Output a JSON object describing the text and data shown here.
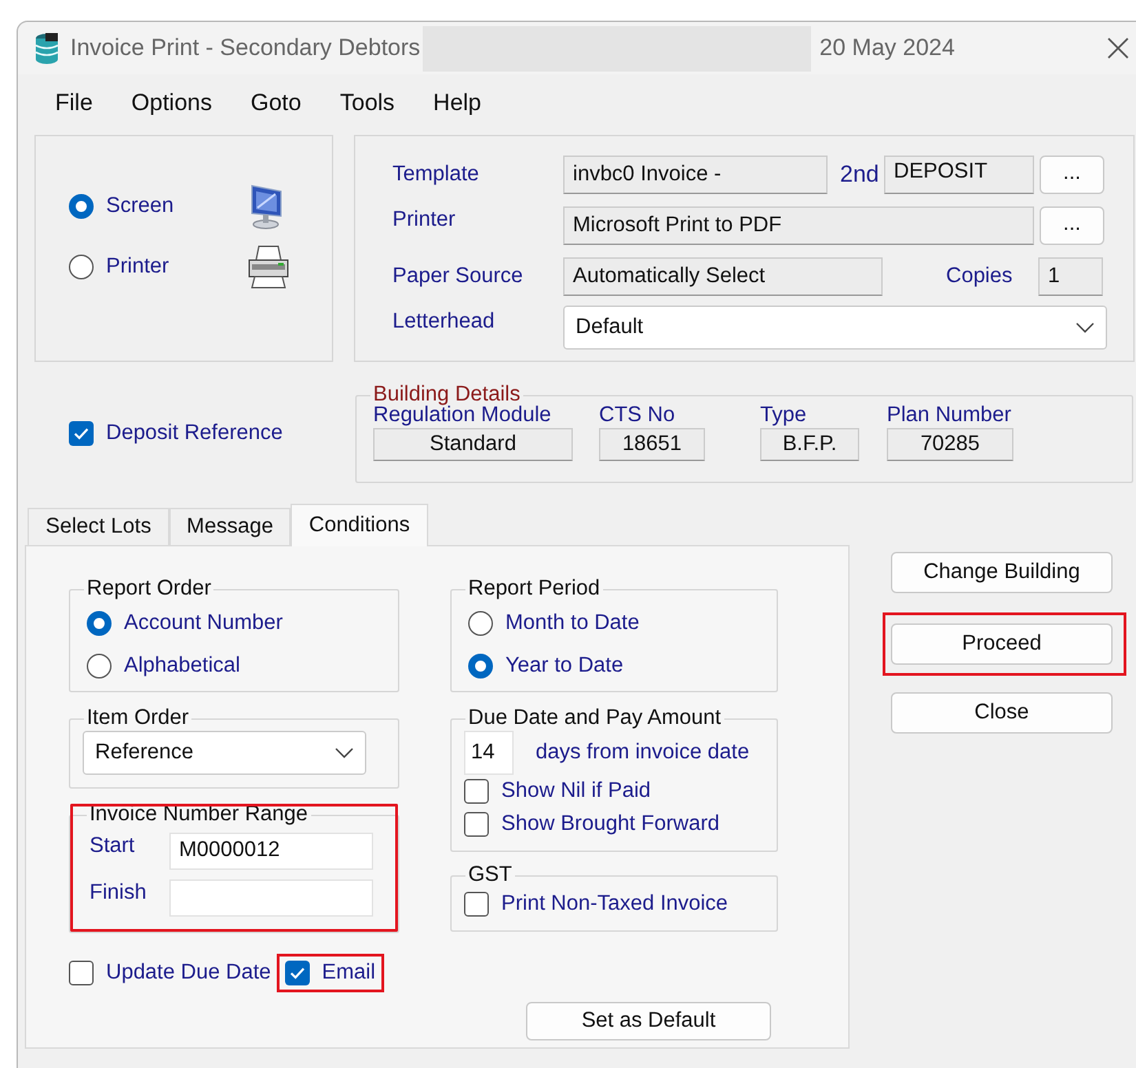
{
  "window": {
    "title": "Invoice Print - Secondary Debtors",
    "date": "20 May 2024"
  },
  "menu": [
    "File",
    "Options",
    "Goto",
    "Tools",
    "Help"
  ],
  "output": {
    "options": [
      {
        "label": "Screen",
        "kind": "screen",
        "selected": true
      },
      {
        "label": "Printer",
        "kind": "printer",
        "selected": false
      }
    ]
  },
  "print_settings": {
    "template": {
      "label": "Template",
      "value": "invbc0 Invoice -",
      "second_label": "2nd",
      "second_value": "DEPOSIT",
      "browse": "..."
    },
    "printer": {
      "label": "Printer",
      "value": "Microsoft Print to PDF",
      "browse": "..."
    },
    "paper_source": {
      "label": "Paper Source",
      "value": "Automatically Select"
    },
    "copies": {
      "label": "Copies",
      "value": "1"
    },
    "letterhead": {
      "label": "Letterhead",
      "value": "Default"
    }
  },
  "deposit_reference": {
    "label": "Deposit Reference",
    "checked": true
  },
  "building_details": {
    "title": "Building Details",
    "fields": [
      {
        "label": "Regulation Module",
        "value": "Standard"
      },
      {
        "label": "CTS No",
        "value": "18651"
      },
      {
        "label": "Type",
        "value": "B.F.P."
      },
      {
        "label": "Plan Number",
        "value": "70285"
      }
    ]
  },
  "tabs": [
    {
      "label": "Select Lots",
      "selected": false
    },
    {
      "label": "Message",
      "selected": false
    },
    {
      "label": "Conditions",
      "selected": true
    }
  ],
  "conditions": {
    "report_order": {
      "title": "Report Order",
      "options": [
        {
          "label": "Account Number",
          "selected": true
        },
        {
          "label": "Alphabetical",
          "selected": false
        }
      ]
    },
    "report_period": {
      "title": "Report Period",
      "options": [
        {
          "label": "Month to Date",
          "selected": false
        },
        {
          "label": "Year to Date",
          "selected": true
        }
      ]
    },
    "item_order": {
      "title": "Item Order",
      "value": "Reference"
    },
    "due_date": {
      "title": "Due Date and Pay Amount",
      "days": "14",
      "days_label": "days from invoice date",
      "options": [
        {
          "label": "Show Nil if Paid",
          "checked": false
        },
        {
          "label": "Show Brought Forward",
          "checked": false
        }
      ]
    },
    "invoice_range": {
      "title": "Invoice Number Range",
      "highlighted": true,
      "start_label": "Start",
      "start": "M0000012",
      "finish_label": "Finish"
    },
    "gst": {
      "title": "GST",
      "options": [
        {
          "label": "Print Non-Taxed Invoice",
          "checked": false
        }
      ]
    },
    "update_due_date": {
      "label": "Update Due Date",
      "checked": false,
      "highlighted": false
    },
    "email": {
      "label": "Email",
      "checked": true,
      "highlighted": true
    },
    "set_default": "Set as Default"
  },
  "actions": [
    {
      "label": "Change Building",
      "highlighted": false
    },
    {
      "label": "Proceed",
      "highlighted": true
    },
    {
      "label": "Close",
      "highlighted": false
    }
  ]
}
